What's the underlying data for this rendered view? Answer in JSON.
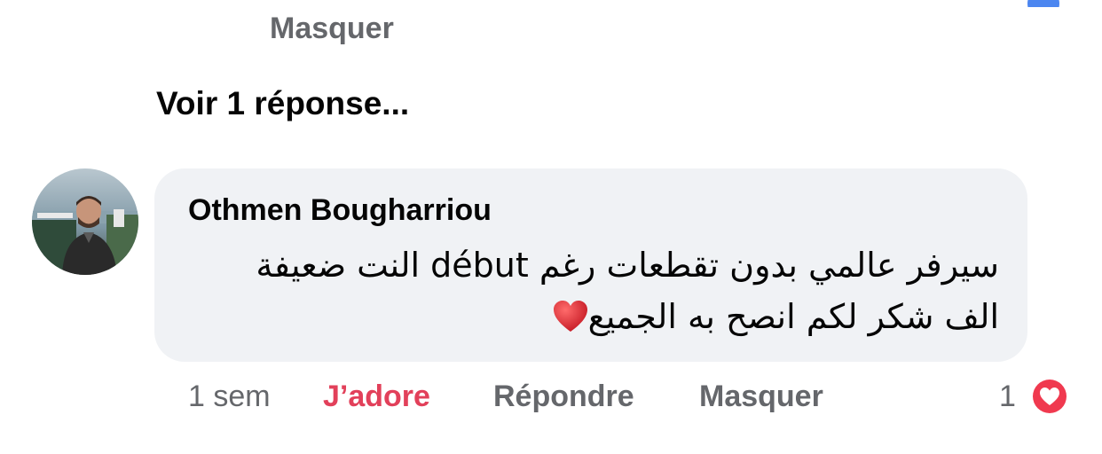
{
  "previous_comment": {
    "hide_label": "Masquer"
  },
  "replies": {
    "see_replies_label": "Voir 1 réponse..."
  },
  "comment": {
    "author": "Othmen Bougharriou",
    "text_line1": "سيرفر عالمي بدون تقطعات رغم début النت ضعيفة",
    "text_line2": "الف شكر لكم انصح به الجميع",
    "avatar_icon": "user-avatar-photo",
    "emoji_icon": "red-heart-icon",
    "time": "1 sem",
    "love_label": "J’adore",
    "reply_label": "Répondre",
    "hide_label": "Masquer",
    "reaction_count": "1",
    "reaction_icon": "love-reaction-icon"
  },
  "colors": {
    "love_accent": "#e2405a",
    "secondary_text": "#65676b",
    "bubble_bg": "#f0f2f5"
  }
}
